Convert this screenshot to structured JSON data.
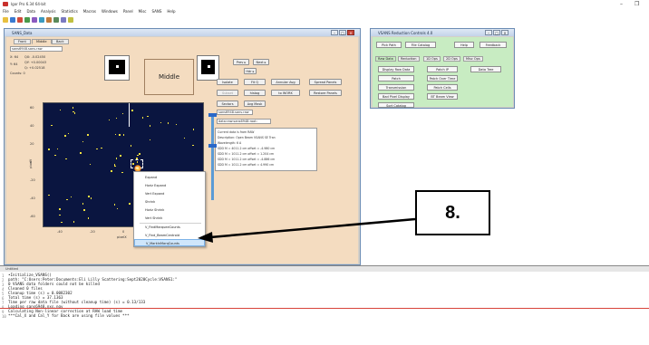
{
  "app": {
    "title": "Igor Pro 6.34 64-bit"
  },
  "menubar": [
    "File",
    "Edit",
    "Data",
    "Analysis",
    "Statistics",
    "Macros",
    "Windows",
    "Panel",
    "Misc",
    "SANS",
    "Help"
  ],
  "sans_window": {
    "title": "SANS_Data",
    "tabs": [
      "Front",
      "Middle",
      "Back"
    ],
    "file_field": "sans6948.sans.raw",
    "x_label": "X: 64",
    "y_label": "Y: 64",
    "qx_label": "QX: -0.02450",
    "qy_label": "QY: +0.00043",
    "q_label": "Q: +0.02518",
    "counts_label": "Counts: 0",
    "x_value": "64",
    "y_value": "64",
    "middle_label": "Middle",
    "buttons": {
      "prev": "Prev ▸",
      "next": "Next ▸",
      "isolate": "Isolate",
      "fit_q": "Fit Q",
      "annular_avg": "Annular Avg",
      "spread_panels": "Spread Panels",
      "subset": "Subset",
      "histog": "histog",
      "to_work": "to WORK",
      "restore_panels": "Restore Panels",
      "sectors": "Sectors",
      "avg_mask": "Avg Mask",
      "hdr": "Hdr ▸"
    },
    "file_field2": "sans6948.sans.raw",
    "path_field": "data:raw:sans6948:root:",
    "info_lines": [
      "Current data is from RAW",
      "Description: Open Beam VSANS SE Tran",
      "Wavelength: 6 A",
      "SDD M = 4011.2 cm  offset = -4.980 cm",
      "SDD M = 1011.2 cm  offset = 1.204 cm",
      "SDD M = 1011.2 cm  offset = -4.886 cm",
      "SDD M = 1011.2 cm  offset = 4.990 cm"
    ],
    "y_ticks": [
      "60",
      "40",
      "20",
      "0",
      "-20",
      "-40",
      "-60"
    ],
    "x_ticks": [
      "-40",
      "-20",
      "0",
      "20",
      "40"
    ],
    "x_axis_label": "pixelX",
    "y_axis_label": "pixelY"
  },
  "context_menu": {
    "items": [
      "Expand",
      "Horiz Expand",
      "Vert Expand",
      "Shrink",
      "Horiz Shrink",
      "Vert Shrink",
      "V_FindMarqueeCounts",
      "V_Find_BeamCentroid",
      "V_MarkInMarqCounts"
    ],
    "selected_index": 8
  },
  "reduction_window": {
    "title": "VSANS Reduction Controls 4.0",
    "top_buttons": [
      "Pick Path",
      "File Catalog",
      "Help",
      "Feedback"
    ],
    "tabs": [
      "Raw Data",
      "Reduction",
      "1D Ops",
      "2D Ops",
      "Misc Ops"
    ],
    "buttons": [
      "Display Raw Data",
      "Patch IP",
      "Data Tree",
      "Patch",
      "Patch Over Time",
      "Transmission",
      "Patch Cells",
      "Bad Pixel Display",
      "BT Beam View",
      "Sort Catalog"
    ]
  },
  "callout": {
    "label": "8."
  },
  "command_window": {
    "title": "Untitled",
    "lines": [
      "•Initialize_VSANS()",
      "  path: \"C:Users:Peter:Documents:Eli Lilly Scattering:Sept2020Cycle:VSANS1:\"",
      "  0 VSANS data folders could not be killed",
      "  Cleaned 0 files",
      "  Cleanup time (s) = 0.0082302",
      "  Total time (s) = 37.1363",
      "  Time per raw data file (without cleanup time) (s) = 0.13/133",
      "  Loading sans6948.nxs.ngv",
      "  Calculating Non-linear correction at RAW load time",
      "  ***Cal_X and Cal_Y for Back are using file values ***"
    ]
  }
}
